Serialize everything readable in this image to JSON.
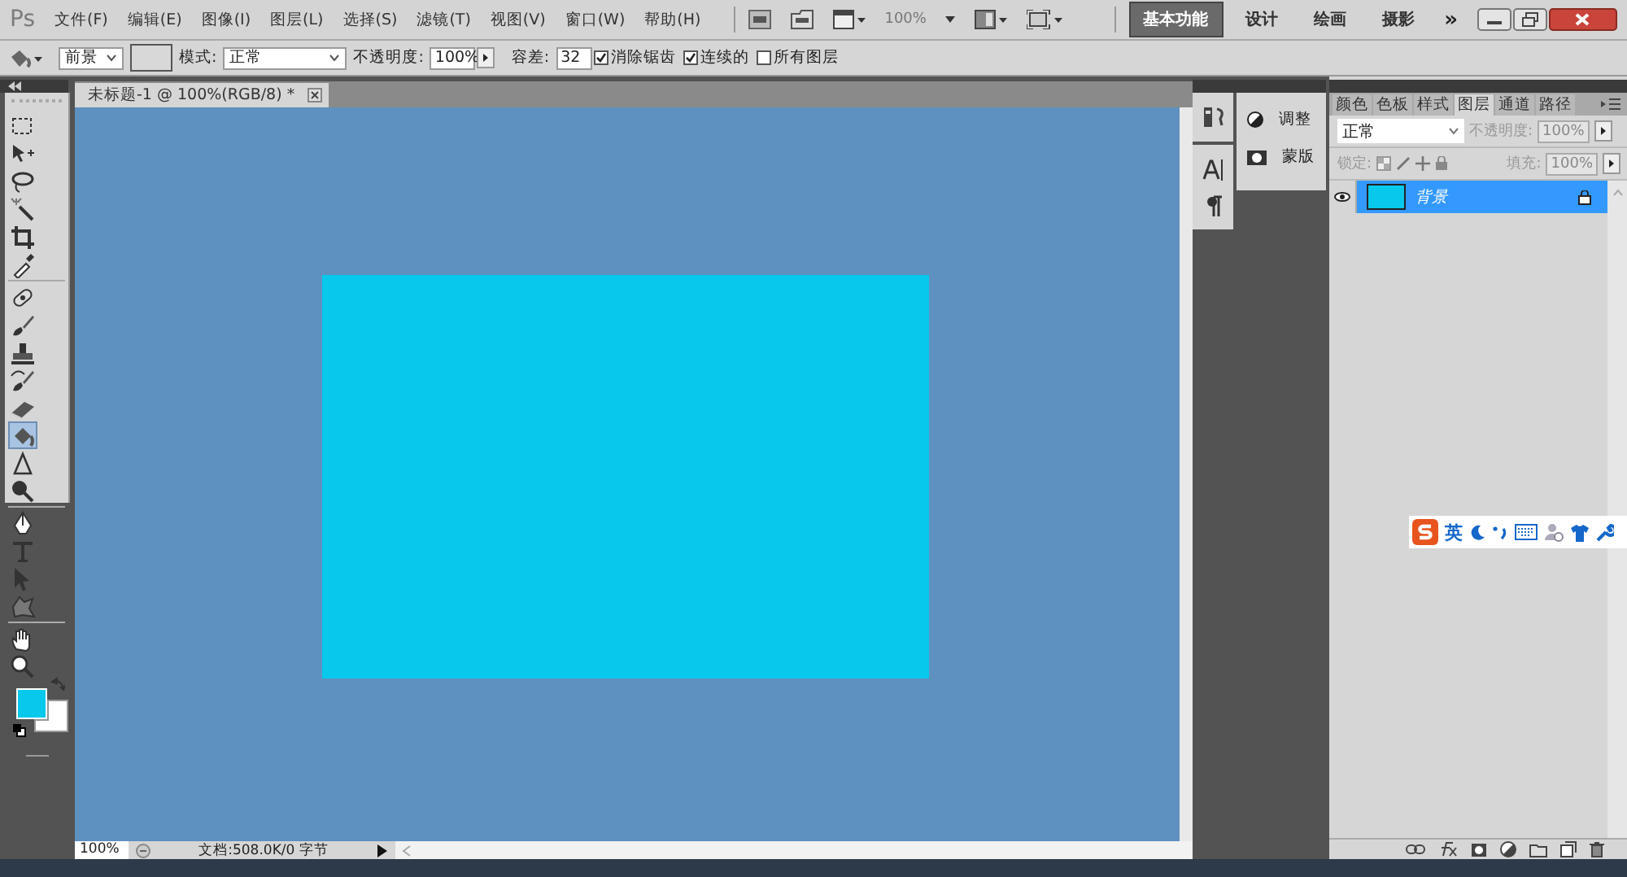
{
  "menubar": {
    "logo": "Ps",
    "menus": [
      "文件(F)",
      "编辑(E)",
      "图像(I)",
      "图层(L)",
      "选择(S)",
      "滤镜(T)",
      "视图(V)",
      "窗口(W)",
      "帮助(H)"
    ],
    "zoom": "100%",
    "workspaces": [
      {
        "label": "基本功能",
        "selected": true
      },
      {
        "label": "设计",
        "selected": false
      },
      {
        "label": "绘画",
        "selected": false
      },
      {
        "label": "摄影",
        "selected": false
      }
    ],
    "more": "»"
  },
  "options": {
    "preset": "前景",
    "mode_label": "模式:",
    "mode": "正常",
    "opacity_label": "不透明度:",
    "opacity": "100%",
    "tolerance_label": "容差:",
    "tolerance": "32",
    "checks": [
      {
        "label": "消除锯齿",
        "checked": true
      },
      {
        "label": "连续的",
        "checked": true
      },
      {
        "label": "所有图层",
        "checked": false
      }
    ]
  },
  "tools": [
    {
      "kind": "marquee",
      "selected": false
    },
    {
      "kind": "move",
      "selected": false
    },
    {
      "kind": "lasso",
      "selected": false
    },
    {
      "kind": "wand",
      "selected": false
    },
    {
      "kind": "crop",
      "selected": false
    },
    {
      "kind": "eyedropper",
      "selected": false
    },
    {
      "kind": "heal",
      "selected": false
    },
    {
      "kind": "brush",
      "selected": false
    },
    {
      "kind": "stamp",
      "selected": false
    },
    {
      "kind": "history",
      "selected": false
    },
    {
      "kind": "eraser",
      "selected": false
    },
    {
      "kind": "bucket",
      "selected": true
    },
    {
      "kind": "blur",
      "selected": false
    },
    {
      "kind": "dodge",
      "selected": false
    },
    {
      "kind": "pen",
      "selected": false
    },
    {
      "kind": "type",
      "selected": false
    },
    {
      "kind": "select",
      "selected": false
    },
    {
      "kind": "shape",
      "selected": false
    },
    {
      "kind": "hand",
      "selected": false
    },
    {
      "kind": "zoom",
      "selected": false
    }
  ],
  "document": {
    "tab": "未标题-1 @ 100%(RGB/8) *",
    "zoom": "100%",
    "info": "文档:508.0K/0 字节"
  },
  "side_panels": [
    "调整",
    "蒙版"
  ],
  "layers_panel": {
    "tabs": [
      {
        "label": "颜色",
        "selected": false
      },
      {
        "label": "色板",
        "selected": false
      },
      {
        "label": "样式",
        "selected": false
      },
      {
        "label": "图层",
        "selected": true
      },
      {
        "label": "通道",
        "selected": false
      },
      {
        "label": "路径",
        "selected": false
      }
    ],
    "blend_mode": "正常",
    "opacity_label": "不透明度:",
    "opacity": "100%",
    "lock_label": "锁定:",
    "fill_label": "填充:",
    "fill": "100%",
    "layers": [
      {
        "name": "背景",
        "selected": true,
        "visible": true,
        "locked": true
      }
    ]
  },
  "ime": {
    "mode": "英"
  }
}
